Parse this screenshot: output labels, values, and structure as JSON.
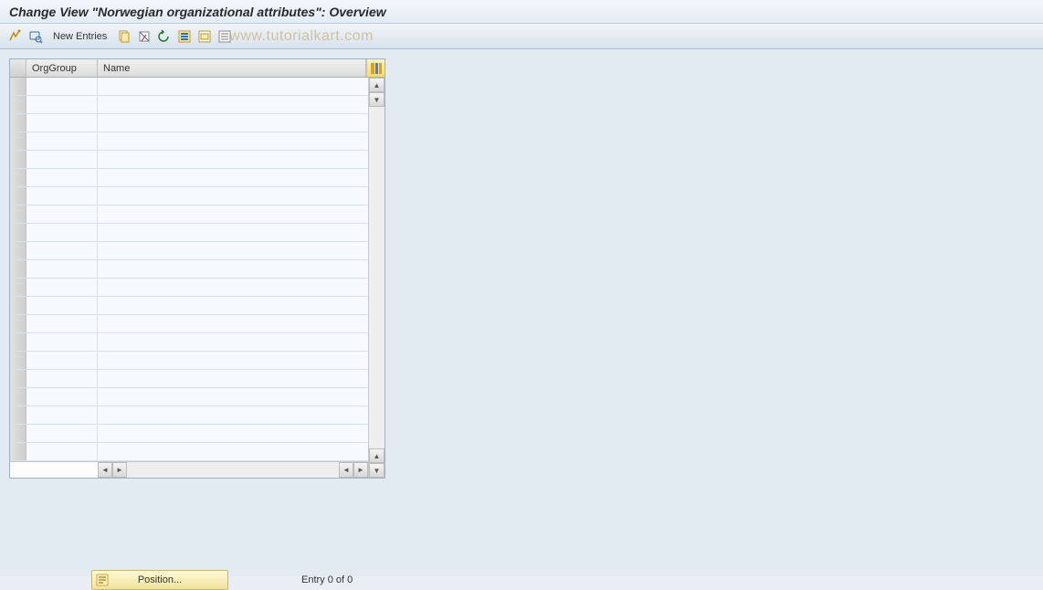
{
  "header": {
    "title": "Change View \"Norwegian organizational attributes\": Overview"
  },
  "toolbar": {
    "new_entries_label": "New Entries"
  },
  "watermark": "www.tutorialkart.com",
  "table": {
    "columns": {
      "orggroup": "OrgGroup",
      "name": "Name"
    },
    "row_count": 21
  },
  "footer": {
    "position_label": "Position...",
    "entry_text": "Entry 0 of 0"
  },
  "icons": {
    "toggle": "toggle-display-change",
    "find": "find",
    "copy": "copy",
    "save": "save",
    "undo": "undo",
    "select_all": "select-all",
    "select_block": "select-block",
    "deselect": "deselect-all",
    "configure": "table-settings",
    "position": "position"
  }
}
